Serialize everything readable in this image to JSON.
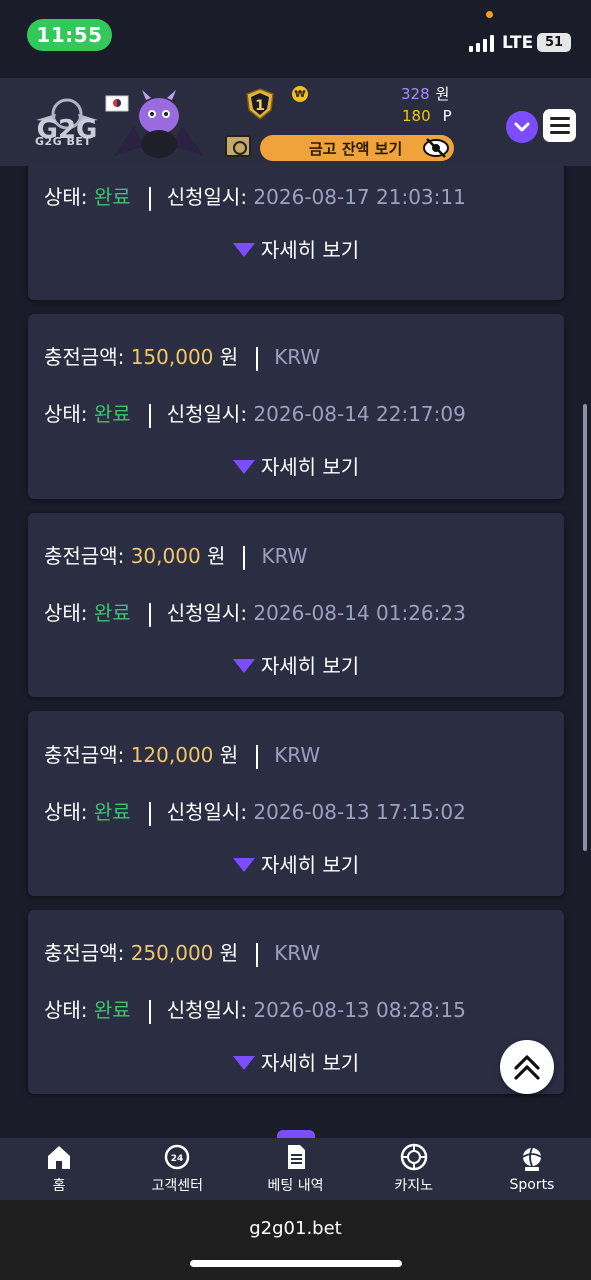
{
  "status_bar": {
    "time": "11:55",
    "network": "LTE",
    "battery": "51"
  },
  "header": {
    "logo_text": "G2G BET",
    "rank_level": "1",
    "won_symbol": "₩",
    "money_value": "328",
    "money_unit": "원",
    "point_value": "180",
    "point_unit": "P",
    "safe_button_label": "금고 잔액 보기"
  },
  "labels": {
    "amount": "충전금액:",
    "currency_unit": "원",
    "currency_code": "KRW",
    "status": "상태:",
    "requested_at": "신청일시:",
    "detail": "자세히 보기"
  },
  "deposits": [
    {
      "amount": null,
      "status": "완료",
      "datetime": "2026-08-17 21:03:11"
    },
    {
      "amount": "150,000",
      "status": "완료",
      "datetime": "2026-08-14 22:17:09"
    },
    {
      "amount": "30,000",
      "status": "완료",
      "datetime": "2026-08-14 01:26:23"
    },
    {
      "amount": "120,000",
      "status": "완료",
      "datetime": "2026-08-13 17:15:02"
    },
    {
      "amount": "250,000",
      "status": "완료",
      "datetime": "2026-08-13 08:28:15"
    }
  ],
  "bottom_nav": [
    {
      "label": "홈",
      "icon": "home-icon"
    },
    {
      "label": "고객센터",
      "icon": "support-24-icon"
    },
    {
      "label": "베팅 내역",
      "icon": "document-icon"
    },
    {
      "label": "카지노",
      "icon": "casino-chip-icon"
    },
    {
      "label": "Sports",
      "icon": "sports-ball-icon"
    }
  ],
  "browser": {
    "url": "g2g01.bet"
  },
  "colors": {
    "accent": "#7c4dff",
    "amount": "#f0c765",
    "success": "#3ec26a",
    "safe_button": "#f0a33a"
  }
}
